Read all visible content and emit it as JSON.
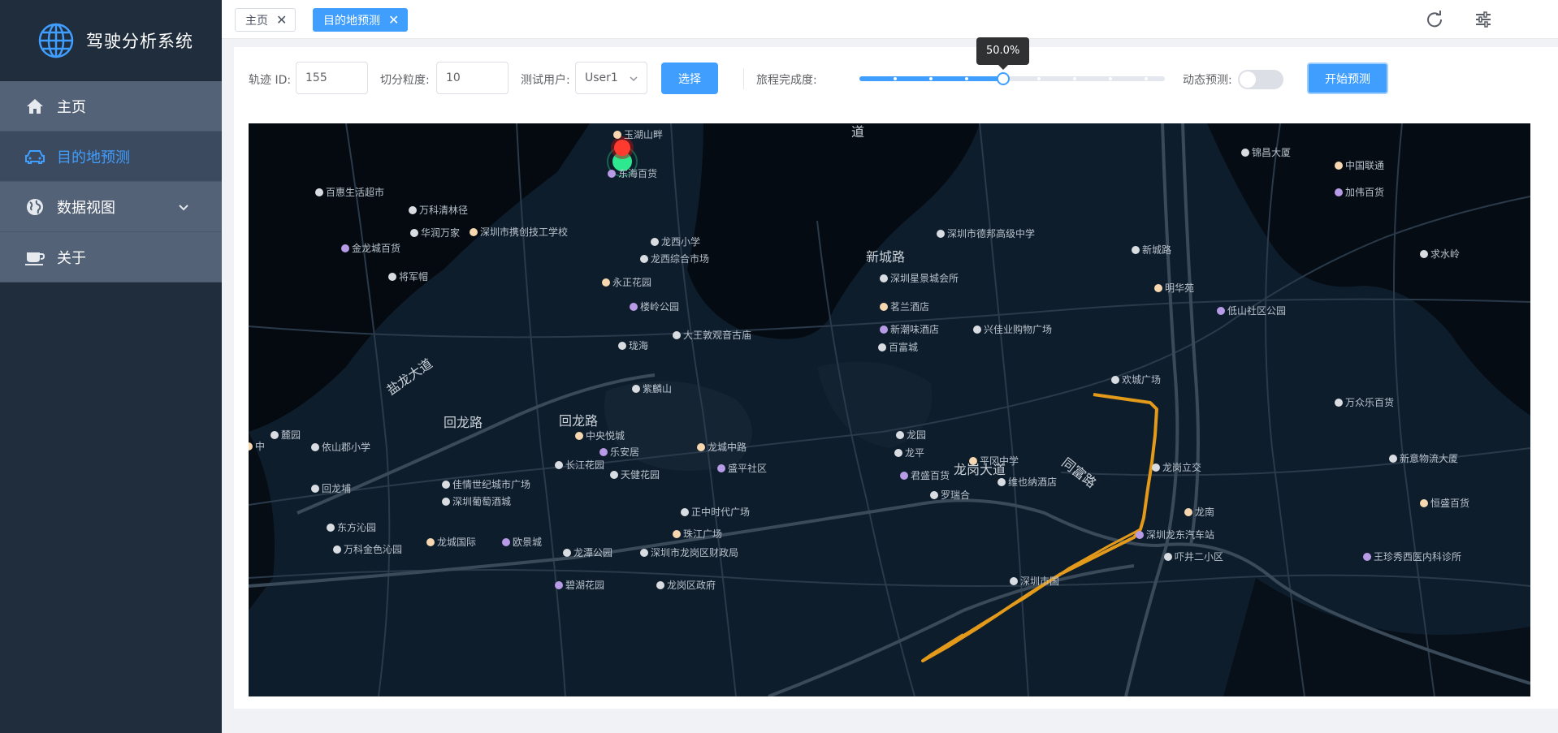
{
  "app": {
    "title": "驾驶分析系统"
  },
  "sidebar": {
    "items": [
      {
        "label": "主页",
        "icon": "home-icon"
      },
      {
        "label": "目的地预测",
        "icon": "car-icon",
        "active": true
      },
      {
        "label": "数据视图",
        "icon": "globe-icon"
      },
      {
        "label": "关于",
        "icon": "cup-icon"
      }
    ]
  },
  "tabs": [
    {
      "label": "主页",
      "active": false
    },
    {
      "label": "目的地预测",
      "active": true
    }
  ],
  "form": {
    "trajectory_label": "轨迹 ID:",
    "trajectory_value": "155",
    "granularity_label": "切分粒度:",
    "granularity_value": "10",
    "user_label": "测试用户:",
    "user_value": "User1",
    "select_button": "选择",
    "progress_label": "旅程完成度:",
    "progress_value": 0.5,
    "progress_text": "50.0%",
    "dynamic_label": "动态预测:",
    "dynamic_on": false,
    "start_button": "开始预测"
  },
  "colors": {
    "primary": "#409eff",
    "sidebar_bg": "#1f2d3d",
    "route": "#e39a1b",
    "start_marker": "#2ee88f",
    "end_marker": "#ff3b2f"
  },
  "map": {
    "road_labels": [
      "道",
      "新城路",
      "回龙路",
      "回龙路",
      "盐龙大道",
      "同富路",
      "龙岗大道"
    ],
    "pois": [
      "玉湖山畔",
      "东海百货",
      "百惠生活超市",
      "万科清林径",
      "华润万家",
      "深圳市携创技工学校",
      "金龙城百货",
      "将军帽",
      "龙西小学",
      "龙西综合市场",
      "永正花园",
      "楼岭公园",
      "大王敦观音古庙",
      "珑海",
      "紫麟山",
      "中央悦城",
      "乐安居",
      "长江花园",
      "佳情世纪城市广场",
      "深圳葡萄酒城",
      "龙城中路",
      "盛平社区",
      "天健花园",
      "东方沁园",
      "万科金色沁园",
      "龙城国际",
      "欧景城",
      "龙潭公园",
      "深圳市龙岗区财政局",
      "正中时代广场",
      "珠江广场",
      "碧湖花园",
      "龙岗区政府",
      "深圳市德邦高级中学",
      "深圳星景城会所",
      "茗兰酒店",
      "新潮味酒店",
      "兴佳业购物广场",
      "百富城",
      "新城路",
      "明华苑",
      "低山社区公园",
      "欢城广场",
      "龙园",
      "龙平",
      "平冈中学",
      "君盛百货",
      "维也纳酒店",
      "罗瑞合",
      "龙岗立交",
      "龙南",
      "深圳龙东汽车站",
      "吓井二小区",
      "深圳市国",
      "锦昌大厦",
      "中国联通",
      "加伟百货",
      "求水岭",
      "万众乐百货",
      "新意物流大厦",
      "恒盛百货",
      "王珍秀西医内科诊所",
      "麓园",
      "依山郡小学",
      "回龙埔",
      "中"
    ]
  }
}
